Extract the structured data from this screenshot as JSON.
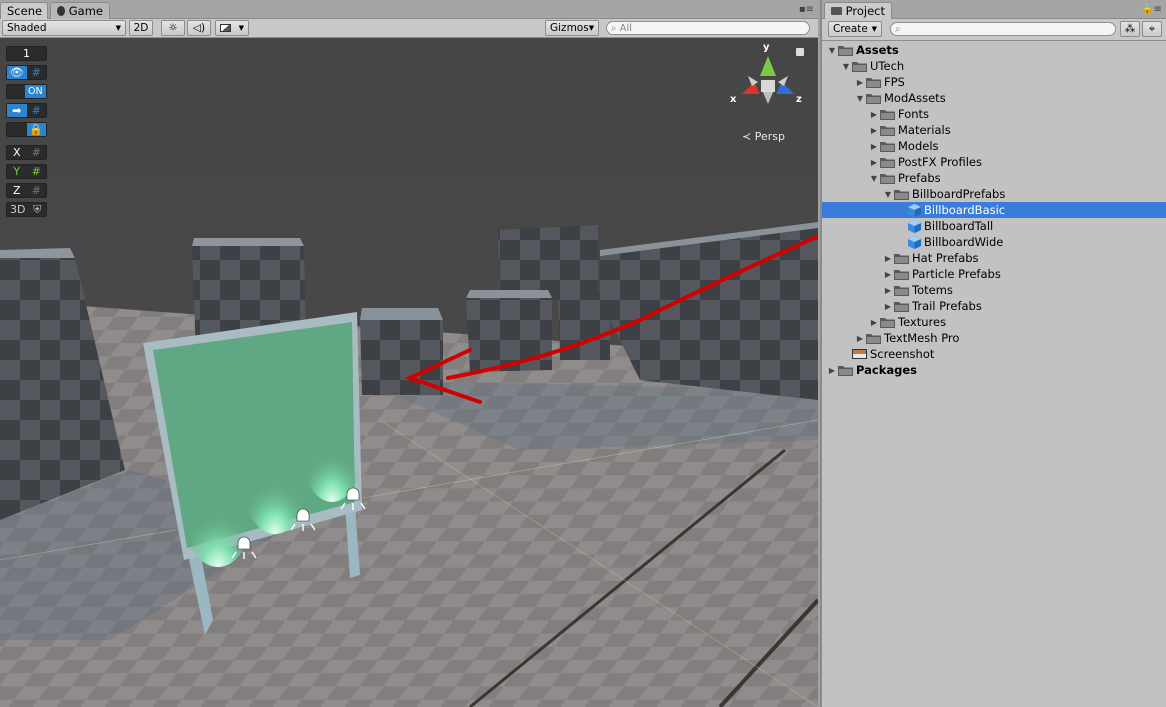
{
  "scene_panel": {
    "tabs": [
      {
        "label": "Scene",
        "active": true
      },
      {
        "label": "Game",
        "active": false
      }
    ],
    "toolbar": {
      "shading_mode": "Shaded",
      "mode_2d": "2D",
      "gizmos": "Gizmos",
      "search_placeholder": "All"
    },
    "overlay": {
      "layer_number": "1",
      "snap_toggle_on": "ON",
      "axis_x": "X",
      "axis_y": "Y",
      "axis_z": "Z",
      "mode_3d": "3D"
    },
    "orientation_gizmo": {
      "y": "y",
      "x": "x",
      "z": "z",
      "projection": "Persp"
    }
  },
  "project_panel": {
    "tab_label": "Project",
    "create_label": "Create",
    "tree": [
      {
        "label": "Assets",
        "depth": 0,
        "expanded": true,
        "icon": "folder",
        "bold": true
      },
      {
        "label": "UTech",
        "depth": 1,
        "expanded": true,
        "icon": "folder"
      },
      {
        "label": "FPS",
        "depth": 2,
        "expanded": false,
        "icon": "folder"
      },
      {
        "label": "ModAssets",
        "depth": 2,
        "expanded": true,
        "icon": "folder"
      },
      {
        "label": "Fonts",
        "depth": 3,
        "expanded": false,
        "icon": "folder"
      },
      {
        "label": "Materials",
        "depth": 3,
        "expanded": false,
        "icon": "folder"
      },
      {
        "label": "Models",
        "depth": 3,
        "expanded": false,
        "icon": "folder"
      },
      {
        "label": "PostFX Profiles",
        "depth": 3,
        "expanded": false,
        "icon": "folder"
      },
      {
        "label": "Prefabs",
        "depth": 3,
        "expanded": true,
        "icon": "folder"
      },
      {
        "label": "BillboardPrefabs",
        "depth": 4,
        "expanded": true,
        "icon": "folder"
      },
      {
        "label": "BillboardBasic",
        "depth": 5,
        "icon": "prefab",
        "selected": true
      },
      {
        "label": "BillboardTall",
        "depth": 5,
        "icon": "prefab"
      },
      {
        "label": "BillboardWide",
        "depth": 5,
        "icon": "prefab"
      },
      {
        "label": "Hat Prefabs",
        "depth": 4,
        "expanded": false,
        "icon": "folder"
      },
      {
        "label": "Particle Prefabs",
        "depth": 4,
        "expanded": false,
        "icon": "folder"
      },
      {
        "label": "Totems",
        "depth": 4,
        "expanded": false,
        "icon": "folder"
      },
      {
        "label": "Trail Prefabs",
        "depth": 4,
        "expanded": false,
        "icon": "folder"
      },
      {
        "label": "Textures",
        "depth": 3,
        "expanded": false,
        "icon": "folder"
      },
      {
        "label": "TextMesh Pro",
        "depth": 2,
        "expanded": false,
        "icon": "folder"
      },
      {
        "label": "Screenshot",
        "depth": 1,
        "icon": "scene"
      },
      {
        "label": "Packages",
        "depth": 0,
        "expanded": false,
        "icon": "folder",
        "bold": true
      }
    ]
  },
  "colors": {
    "selection": "#3b7bd9",
    "annotation_arrow": "#d10000",
    "billboard_screen": "#5fa883",
    "axis_x": "#d8352a",
    "axis_y": "#7ac943",
    "axis_z": "#2f6fd6"
  }
}
